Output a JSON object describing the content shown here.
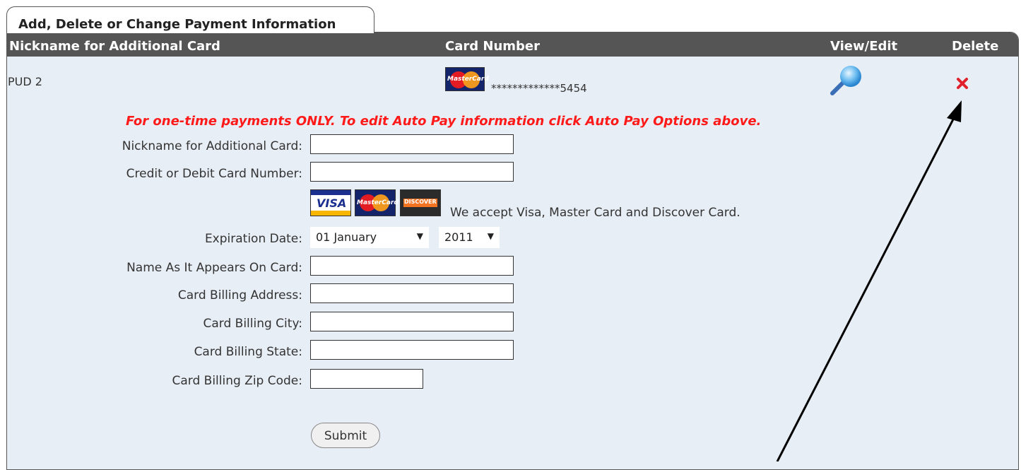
{
  "tab": {
    "title": "Add, Delete or Change Payment Information"
  },
  "table": {
    "headers": {
      "nickname": "Nickname for Additional Card",
      "card_number": "Card Number",
      "view_edit": "View/Edit",
      "delete": "Delete"
    },
    "rows": [
      {
        "nickname": "PUD 2",
        "card_number": "*************5454",
        "card_brand": "MasterCard"
      }
    ]
  },
  "form": {
    "notice": "For one-time payments ONLY. To edit Auto Pay information click Auto Pay Options above.",
    "fields": {
      "nickname": {
        "label": "Nickname for Additional Card:",
        "value": ""
      },
      "card_number": {
        "label": "Credit or Debit Card Number:",
        "value": ""
      },
      "expiration": {
        "label": "Expiration Date:",
        "month": "01 January",
        "year": "2011"
      },
      "name": {
        "label": "Name As It Appears On Card:",
        "value": ""
      },
      "address": {
        "label": "Card Billing Address:",
        "value": ""
      },
      "city": {
        "label": "Card Billing City:",
        "value": ""
      },
      "state": {
        "label": "Card Billing State:",
        "value": ""
      },
      "zip": {
        "label": "Card Billing Zip Code:",
        "value": ""
      }
    },
    "accept_text": "We accept Visa, Master Card and Discover Card.",
    "card_logos": [
      {
        "icon": "visa-logo-icon",
        "text": "VISA"
      },
      {
        "icon": "mastercard-logo-icon",
        "text": "MasterCard"
      },
      {
        "icon": "discover-logo-icon",
        "text": "DISCOVER"
      }
    ],
    "submit_label": "Submit"
  },
  "icons": {
    "view": "magnifier-icon",
    "delete": "delete-x-icon",
    "annotation": "annotation-arrow-icon"
  },
  "colors": {
    "header_bg": "#555555",
    "panel_bg": "#e8eef6",
    "notice": "#ff1a1a",
    "delete_icon": "#e0202a"
  }
}
